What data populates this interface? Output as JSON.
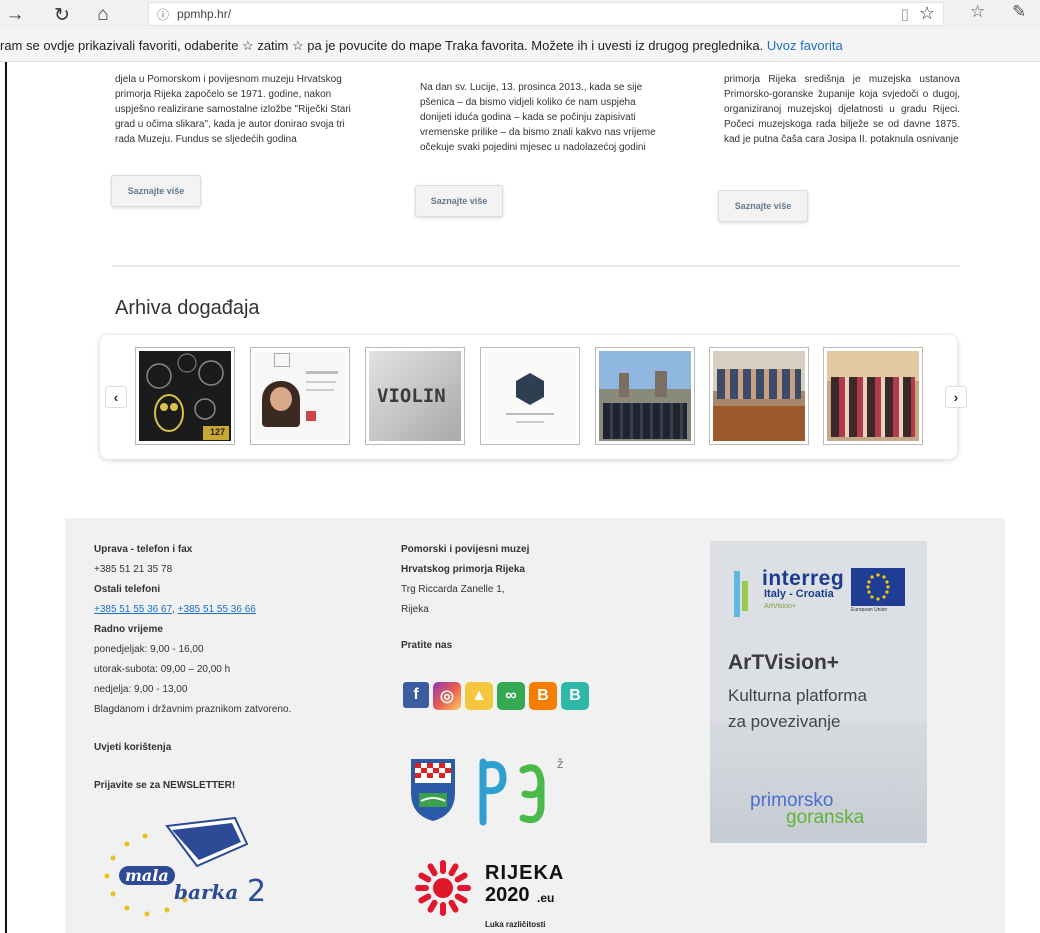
{
  "browser": {
    "url": "ppmhp.hr/",
    "favorites_bar_text": "ram se ovdje prikazivali favoriti, odaberite  ☆  zatim ☆ pa je povucite do mape Traka favorita. Možete ih i uvesti iz drugog preglednika.",
    "import_link": "Uvoz favorita"
  },
  "articles": [
    {
      "title": "",
      "text": "djela u Pomorskom i povijesnom muzeju Hrvatskog primorja Rijeka započelo se 1971. godine, nakon uspješno realizirane samostalne izložbe \"Riječki Stari grad u očima slikara\", kada je autor donirao svoja tri rada Muzeju. Fundus se sljedećih godina",
      "button": "Saznajte više"
    },
    {
      "title": "",
      "text": "Na dan sv. Lucije, 13. prosinca 2013., kada se sije pšenica – da bismo vidjeli koliko će nam uspjeha donijeti iduća godina – kada se počinju zapisivati vremenske prilike – da bismo znali kakvo nas vrijeme očekuje svaki pojedini mjesec u nadolazećoj godini",
      "button": "Saznajte više"
    },
    {
      "title": "",
      "text": "primorja Rijeka središnja je muzejska ustanova Primorsko-goranske županije koja svjedoči o dugoj, organiziranoj muzejskoj djelatnosti u gradu Rijeci. Počeci muzejskoga rada bilježe se od davne 1875. kad je putna čaša cara Josipa II. potaknula osnivanje",
      "button": "Saznajte više"
    }
  ],
  "archive": {
    "title": "Arhiva događaja",
    "prev": "‹",
    "next": "›",
    "thumb_label_violin": "VIOLIN",
    "thumb_label_badge": "127"
  },
  "footer": {
    "uprava_label": "Uprava - telefon i fax",
    "uprava_phone": "+385 51 21 35 78",
    "ostali_label": "Ostali telefoni",
    "phone_1": "+385 51 55 36 67",
    "phone_sep": ", ",
    "phone_2": "+385 51 55 36 66",
    "radno_label": "Radno vrijeme",
    "hours_1": "ponedjeljak: 9,00 - 16,00",
    "hours_2": "utorak-subota: 09,00 – 20,00 h",
    "hours_3": "nedjelja: 9,00 - 13,00",
    "hours_4": "Blagdanom i državnim praznikom zatvoreno.",
    "terms": "Uvjeti korištenja",
    "newsletter": "Prijavite se za NEWSLETTER!",
    "museum_name_1": "Pomorski i povijesni muzej",
    "museum_name_2": "Hrvatskog primorja Rijeka",
    "address_1": "Trg Riccarda Zanelle 1,",
    "address_2": "Rijeka",
    "follow": "Pratite nas",
    "logo_mala": "mala",
    "logo_barka": "barka",
    "logo_2": "2",
    "rijeka_1": "RIJEKA",
    "rijeka_2": "2020",
    "rijeka_eu": ".eu",
    "rijeka_tag": "Luka različitosti"
  },
  "banner": {
    "interreg": "interreg",
    "program": "Italy - Croatia",
    "small": "ArtVision+",
    "eu_caption": "European Union",
    "title": "ArTVision+",
    "subtitle_1": "Kulturna platforma",
    "subtitle_2": "za povezivanje",
    "pg_1": "primorsko",
    "pg_2": "goranska"
  }
}
